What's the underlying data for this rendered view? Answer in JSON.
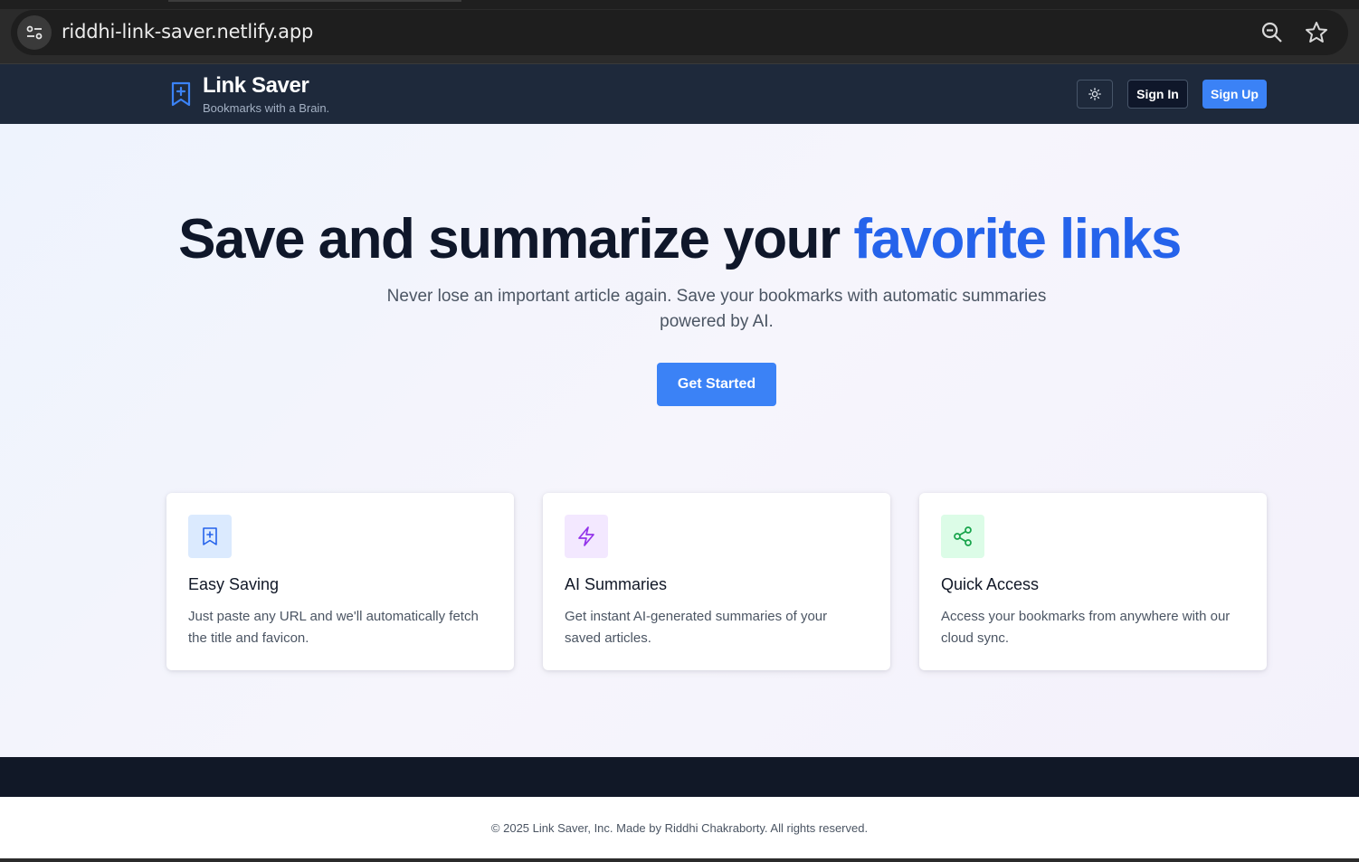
{
  "browser": {
    "url": "riddhi-link-saver.netlify.app",
    "icons": [
      "site-info-icon",
      "zoom-icon",
      "bookmark-star-icon"
    ]
  },
  "header": {
    "brand_title": "Link Saver",
    "brand_tagline": "Bookmarks with a Brain.",
    "brand_icon": "bookmark-plus-icon",
    "theme_icon": "sun-icon",
    "signin_label": "Sign In",
    "signup_label": "Sign Up"
  },
  "hero": {
    "title_main": "Save and summarize your ",
    "title_highlight": "favorite links",
    "subtitle": "Never lose an important article again. Save your bookmarks with automatic summaries powered by AI.",
    "cta_label": "Get Started"
  },
  "features": [
    {
      "title": "Easy Saving",
      "text": "Just paste any URL and we'll automatically fetch the title and favicon.",
      "icon": "bookmark-plus-icon",
      "icon_bg": "#dbeafe",
      "icon_color": "#2563eb"
    },
    {
      "title": "AI Summaries",
      "text": "Get instant AI-generated summaries of your saved articles.",
      "icon": "lightning-icon",
      "icon_bg": "#f3e8ff",
      "icon_color": "#9333ea"
    },
    {
      "title": "Quick Access",
      "text": "Access your bookmarks from anywhere with our cloud sync.",
      "icon": "share-icon",
      "icon_bg": "#dcfce7",
      "icon_color": "#16a34a"
    }
  ],
  "footer": {
    "copyright": "© 2025 Link Saver, Inc. Made by Riddhi Chakraborty. All rights reserved."
  },
  "colors": {
    "accent": "#3b82f6",
    "header_bg": "#1e293b",
    "title_dark": "#0f172a",
    "highlight": "#2563eb"
  }
}
